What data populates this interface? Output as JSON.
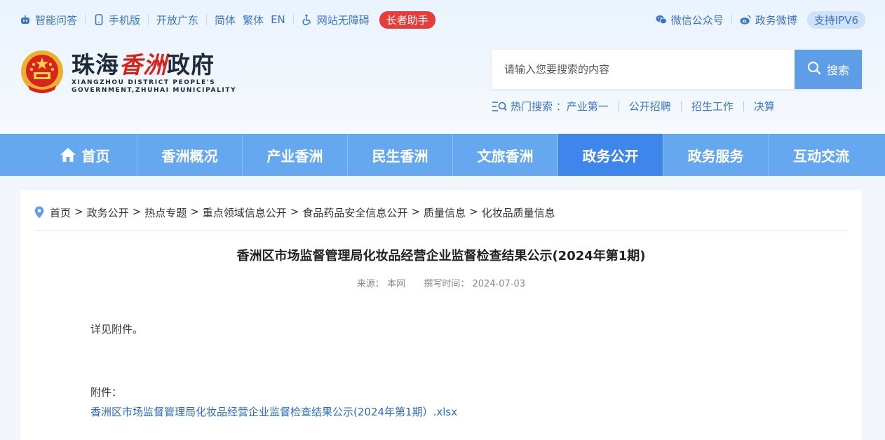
{
  "topbar": {
    "ai_qa": "智能问答",
    "mobile": "手机版",
    "open_gd": "开放广东",
    "lang": [
      "简体",
      "繁体",
      "EN"
    ],
    "accessibility": "网站无障碍",
    "elder": "长者助手",
    "wechat": "微信公众号",
    "weibo": "政务微博",
    "ipv6": "支持IPV6"
  },
  "logo": {
    "title_a": "珠海",
    "title_red": "香洲",
    "title_b": "政府",
    "en_line1": "XIANGZHOU DISTRICT PEOPLE'S",
    "en_line2": "GOVERNMENT,ZHUHAI MUNICIPALITY"
  },
  "search": {
    "placeholder": "请输入您要搜索的内容",
    "button": "搜索"
  },
  "hot_search": {
    "label": "热门搜索 ：",
    "items": [
      "产业第一",
      "公开招聘",
      "招生工作",
      "决算"
    ]
  },
  "nav": {
    "items": [
      "首页",
      "香洲概况",
      "产业香洲",
      "民生香洲",
      "文旅香洲",
      "政务公开",
      "政务服务",
      "互动交流"
    ],
    "active_index": 5
  },
  "breadcrumb": [
    "首页",
    "政务公开",
    "热点专题",
    "重点领域信息公开",
    "食品药品安全信息公开",
    "质量信息",
    "化妆品质量信息"
  ],
  "article": {
    "title": "香洲区市场监督管理局化妆品经营企业监督检查结果公示(2024年第1期)",
    "source_label": "来源：",
    "source": "本网",
    "time_label": "撰写时间：",
    "time": "2024-07-03",
    "body": "详见附件。",
    "attach_label": "附件：",
    "attach_file": "香洲区市场监督管理局化妆品经营企业监督检查结果公示(2024年第1期）.xlsx"
  },
  "colors": {
    "nav_bg": "#65a8ef",
    "nav_active": "#3f86ec",
    "accent": "#3a74c4",
    "elder_red": "#e63c3c"
  }
}
